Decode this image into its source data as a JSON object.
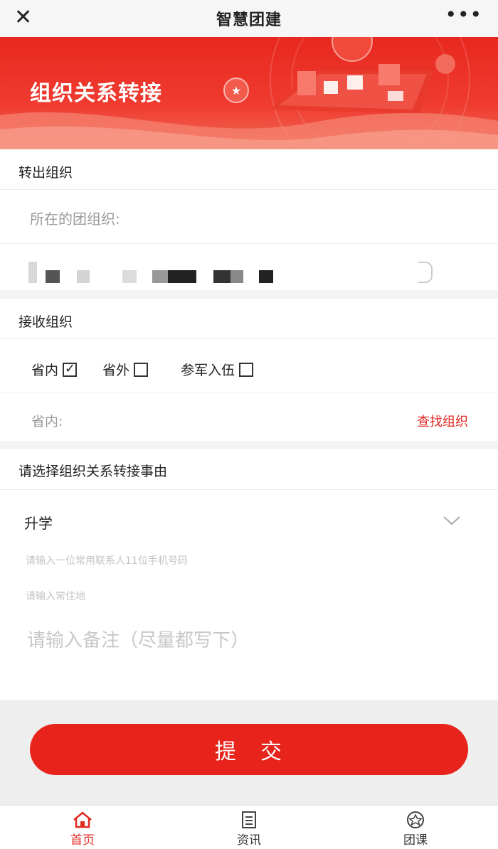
{
  "window": {
    "title": "智慧团建",
    "close_glyph": "✕",
    "more_glyph": "•••"
  },
  "banner": {
    "title": "组织关系转接"
  },
  "transfer_out": {
    "header": "转出组织",
    "placeholder": "所在的团组织:"
  },
  "receive": {
    "header": "接收组织",
    "options": [
      {
        "label": "省内",
        "checked": true
      },
      {
        "label": "省外",
        "checked": false
      },
      {
        "label": "参军入伍",
        "checked": false
      }
    ],
    "province_label": "省内:",
    "find_label": "查找组织"
  },
  "reason": {
    "header": "请选择组织关系转接事由",
    "selected": "升学",
    "phone_placeholder": "请输入一位常用联系人11位手机号码",
    "address_placeholder": "请输入常住地",
    "remark_placeholder": "请输入备注（尽量都写下）"
  },
  "submit": {
    "label": "提　交"
  },
  "tabs": [
    {
      "label": "首页",
      "icon": "home-icon",
      "active": true
    },
    {
      "label": "资讯",
      "icon": "news-icon",
      "active": false
    },
    {
      "label": "团课",
      "icon": "course-icon",
      "active": false
    }
  ],
  "colors": {
    "accent": "#e8231c",
    "link": "#e02a22"
  }
}
